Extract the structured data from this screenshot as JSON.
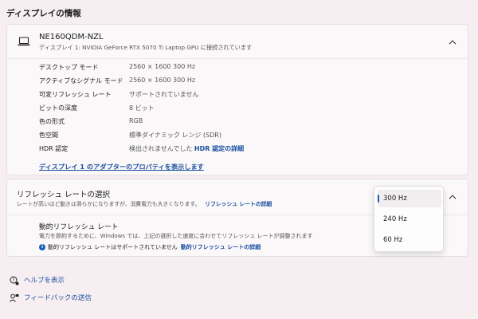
{
  "section_title": "ディスプレイの情報",
  "display": {
    "name": "NE160QDM-NZL",
    "subtitle": "ディスプレイ 1: NVIDIA GeForce RTX 5070 Ti Laptop GPU に接続されています",
    "rows": [
      {
        "label": "デスクトップ モード",
        "value": "2560 × 1600 300 Hz"
      },
      {
        "label": "アクティブなシグナル モード",
        "value": "2560 × 1600 300 Hz"
      },
      {
        "label": "可変リフレッシュ レート",
        "value": "サポートされていません"
      },
      {
        "label": "ビットの深度",
        "value": "8 ビット"
      },
      {
        "label": "色の形式",
        "value": "RGB"
      },
      {
        "label": "色空間",
        "value": "標準ダイナミック レンジ (SDR)"
      },
      {
        "label": "HDR 認定",
        "value": "検出されませんでした",
        "link": "HDR 認定の詳細"
      }
    ],
    "adapter_link": "ディスプレイ 1 のアダプターのプロパティを表示します"
  },
  "refresh": {
    "title": "リフレッシュ レートの選択",
    "desc": "レートが高いほど動きは滑らかになりますが、消費電力も大きくなります。",
    "desc_link": "リフレッシュ レートの詳細",
    "dynamic_title": "動的リフレッシュ レート",
    "dynamic_desc": "電力を節約するために、Windows では、上記の選択した速度に合わせてリフレッシュ レートが調整されます",
    "dynamic_info": "動的リフレッシュ レートはサポートされていません",
    "dynamic_info_link": "動的リフレッシュ レートの詳細",
    "options": [
      "300 Hz",
      "240 Hz",
      "60 Hz"
    ],
    "selected": "300 Hz"
  },
  "links": {
    "help": "ヘルプを表示",
    "feedback": "フィードバックの送信"
  },
  "colors": {
    "accent": "#1a5fb4",
    "link": "#1a4fa0",
    "background": "#f6eef0"
  }
}
